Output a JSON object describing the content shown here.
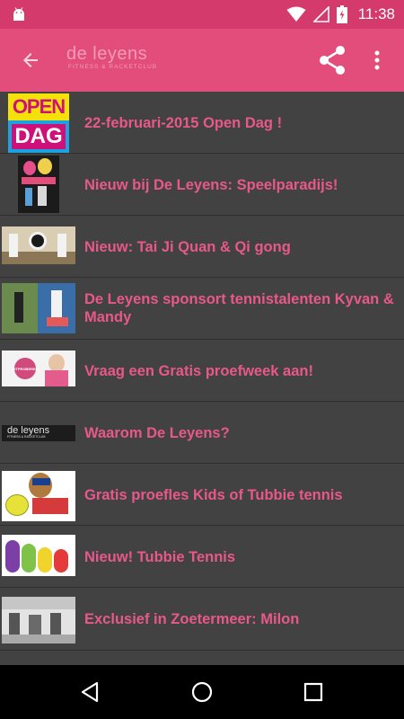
{
  "status_bar": {
    "time": "11:38",
    "icons": [
      "android-icon",
      "wifi-icon",
      "signal-icon",
      "battery-icon"
    ]
  },
  "app_bar": {
    "logo_text": "de leyens",
    "logo_subtitle": "FITNESS & RACKETCLUB",
    "icons": [
      "back-arrow-icon",
      "share-icon",
      "more-vert-icon"
    ],
    "background": "#e34d7c"
  },
  "news": {
    "title_color": "#e8588a",
    "items": [
      {
        "title": "22-februari-2015 Open Dag !",
        "thumb": "open-dag"
      },
      {
        "title": "Nieuw bij De Leyens: Speelparadijs!",
        "thumb": "speelparadijs"
      },
      {
        "title": "Nieuw: Tai Ji Quan & Qi gong",
        "thumb": "tai-ji"
      },
      {
        "title": "De Leyens sponsort tennistalenten Kyvan & Mandy",
        "thumb": "tennis"
      },
      {
        "title": "Vraag een Gratis proefweek aan!",
        "thumb": "proefweek"
      },
      {
        "title": "Waarom De Leyens?",
        "thumb": "logo"
      },
      {
        "title": "Gratis proefles Kids of Tubbie tennis",
        "thumb": "kids-tennis"
      },
      {
        "title": "Nieuw! Tubbie Tennis",
        "thumb": "tubbies"
      },
      {
        "title": "Exclusief in Zoetermeer: Milon",
        "thumb": "milon"
      }
    ]
  },
  "thumb_text": {
    "open": "OPEN",
    "dag": "DAG",
    "proefweek_badge": "UITPROBEREN",
    "logo_main": "de leyens",
    "logo_sub": "FITNESS & RACKETCLUB"
  },
  "nav_bar": {
    "icons": [
      "back-triangle-icon",
      "home-circle-icon",
      "recents-square-icon"
    ]
  }
}
